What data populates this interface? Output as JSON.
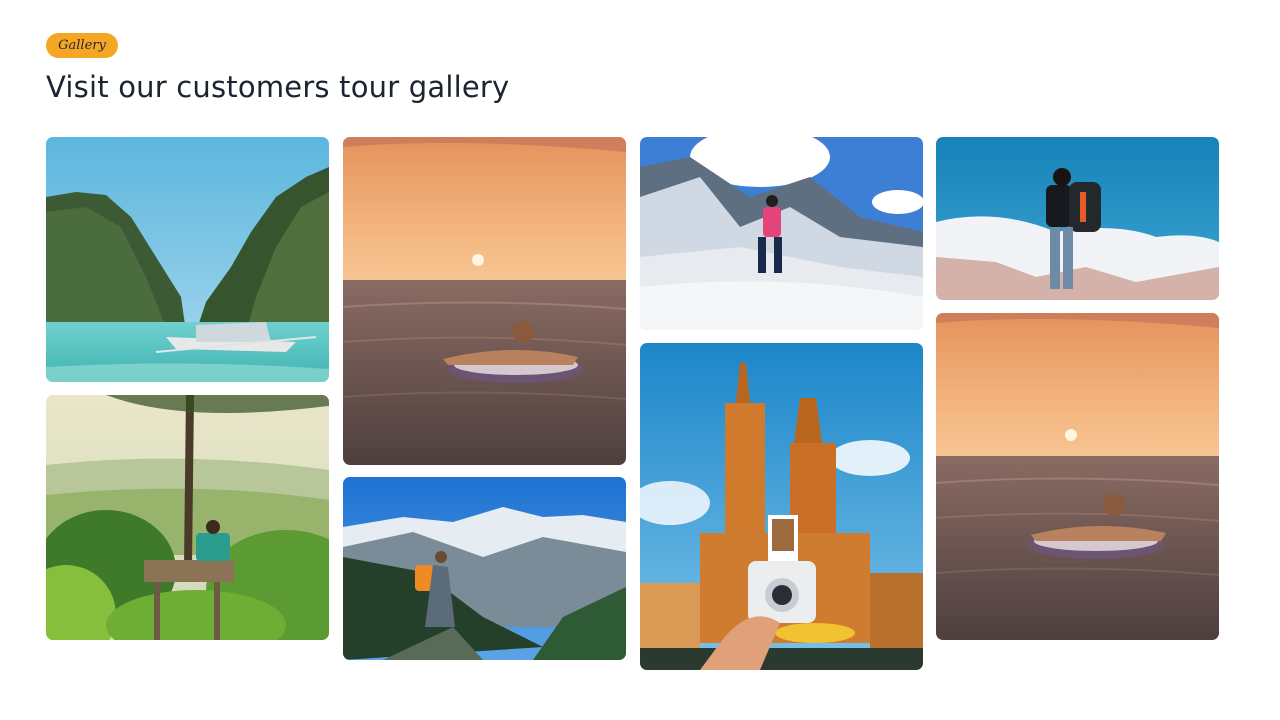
{
  "section": {
    "badge": "Gallery",
    "title": "Visit our customers tour gallery"
  },
  "gallery": {
    "photos": [
      {
        "name": "tropical-lagoon-boat-photo"
      },
      {
        "name": "treehouse-forest-view-photo"
      },
      {
        "name": "sunset-sea-float-photo"
      },
      {
        "name": "mountain-hiker-backpack-photo"
      },
      {
        "name": "snow-mountain-climber-photo"
      },
      {
        "name": "church-instant-camera-photo"
      },
      {
        "name": "hiker-above-clouds-photo"
      },
      {
        "name": "sunset-sea-float-photo-2"
      }
    ]
  }
}
